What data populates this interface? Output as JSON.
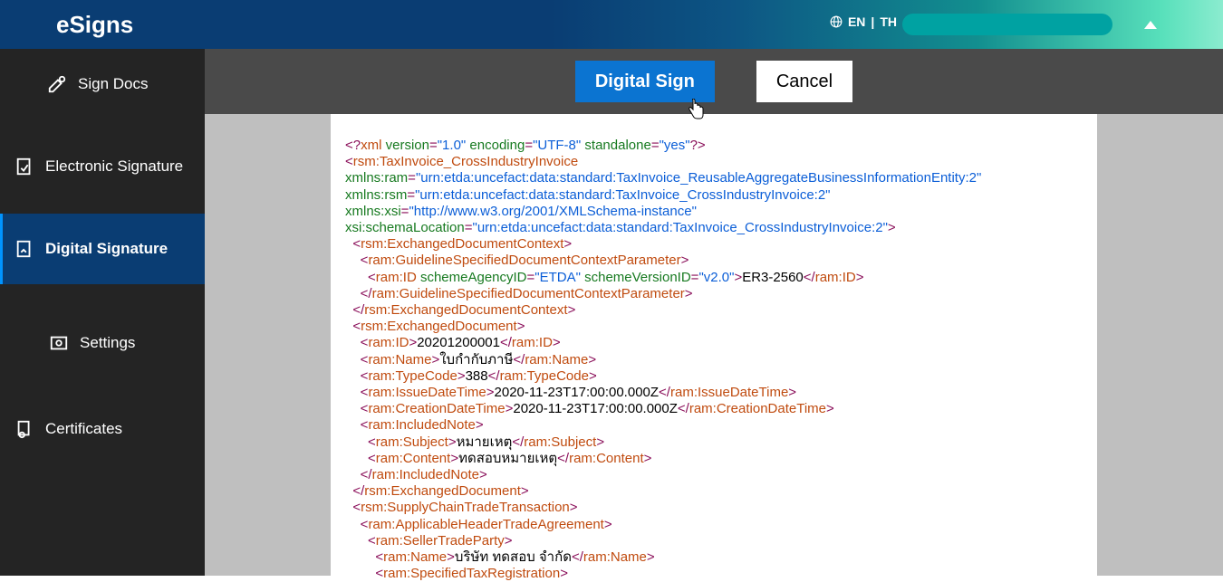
{
  "header": {
    "logo": "eSigns",
    "lang_en": "EN",
    "lang_sep": "|",
    "lang_th": "TH"
  },
  "sidebar": {
    "item0": "Sign Docs",
    "item1": "Electronic Signature",
    "item2": "Digital Signature",
    "item3": "Settings",
    "item4": "Certificates"
  },
  "actions": {
    "sign": "Digital Sign",
    "cancel": "Cancel"
  },
  "xml": {
    "decl_xml": "xml",
    "decl_version_a": "version",
    "decl_version_v": "\"1.0\"",
    "decl_encoding_a": "encoding",
    "decl_encoding_v": "\"UTF-8\"",
    "decl_standalone_a": "standalone",
    "decl_standalone_v": "\"yes\"",
    "root": "rsm:TaxInvoice_CrossIndustryInvoice",
    "ns_ram_a": "xmlns:ram",
    "ns_ram_v": "\"urn:etda:uncefact:data:standard:TaxInvoice_ReusableAggregateBusinessInformationEntity:2\"",
    "ns_rsm_a": "xmlns:rsm",
    "ns_rsm_v": "\"urn:etda:uncefact:data:standard:TaxInvoice_CrossIndustryInvoice:2\"",
    "ns_xsi_a": "xmlns:xsi",
    "ns_xsi_v": "\"http://www.w3.org/2001/XMLSchema-instance\"",
    "schemaLoc_a": "xsi:schemaLocation",
    "schemaLoc_v": "\"urn:etda:uncefact:data:standard:TaxInvoice_CrossIndustryInvoice:2\"",
    "edc": "rsm:ExchangedDocumentContext",
    "gsdcp": "ram:GuidelineSpecifiedDocumentContextParameter",
    "ramID": "ram:ID",
    "schemeAgency_a": "schemeAgencyID",
    "schemeAgency_v": "\"ETDA\"",
    "schemeVersion_a": "schemeVersionID",
    "schemeVersion_v": "\"v2.0\"",
    "guideline_id": "ER3-2560",
    "ed": "rsm:ExchangedDocument",
    "doc_id": "20201200001",
    "ramName": "ram:Name",
    "doc_name": "ใบกำกับภาษี",
    "typeCode": "ram:TypeCode",
    "doc_type": "388",
    "issue": "ram:IssueDateTime",
    "issue_val": "2020-11-23T17:00:00.000Z",
    "creation": "ram:CreationDateTime",
    "creation_val": "2020-11-23T17:00:00.000Z",
    "note": "ram:IncludedNote",
    "subject": "ram:Subject",
    "subject_val": "หมายเหตุ",
    "content": "ram:Content",
    "content_val": "ทดสอบหมายเหตุ",
    "sctt": "rsm:SupplyChainTradeTransaction",
    "ahta": "ram:ApplicableHeaderTradeAgreement",
    "seller": "ram:SellerTradeParty",
    "seller_name": "บริษัท ทดสอบ จำกัด",
    "str": "ram:SpecifiedTaxRegistration"
  }
}
